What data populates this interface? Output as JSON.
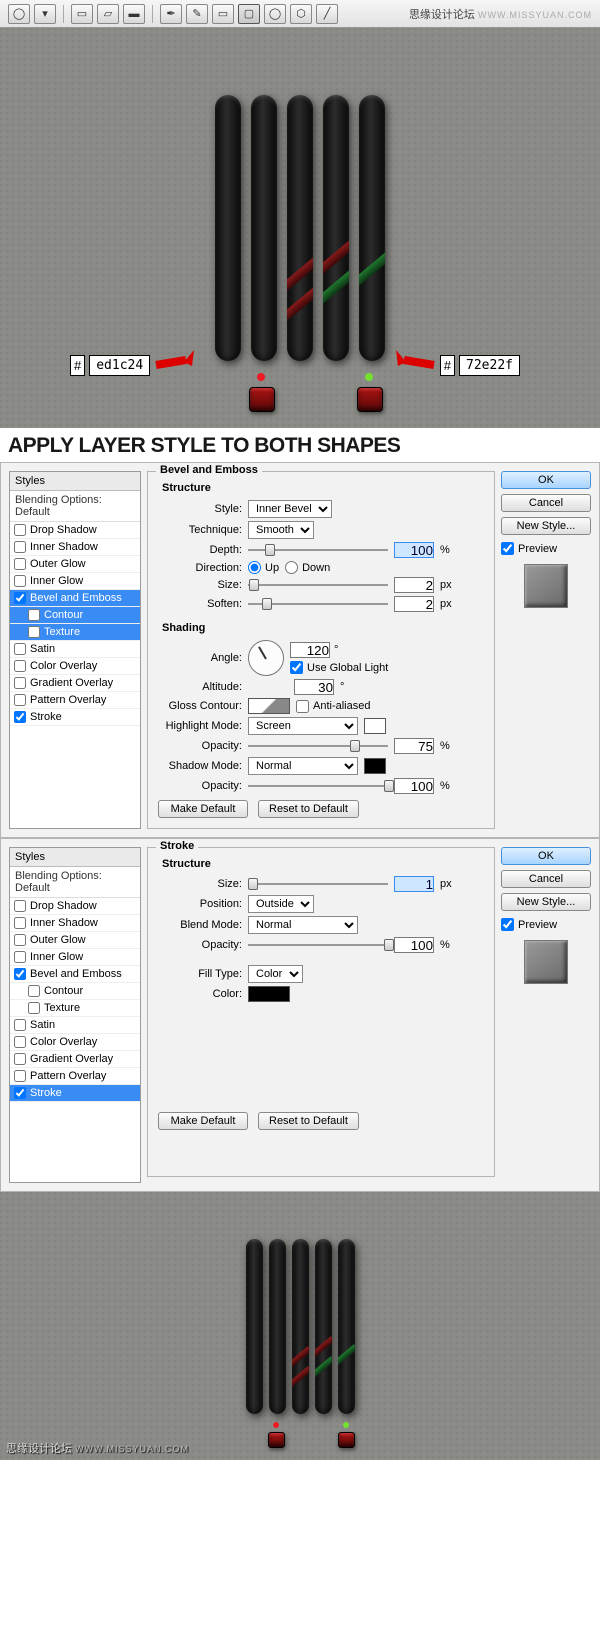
{
  "watermark": {
    "main": "思缘设计论坛",
    "sub": "WWW.MISSYUAN.COM"
  },
  "heading": "APPLY LAYER STYLE TO BOTH SHAPES",
  "colors": {
    "red_hex": "ed1c24",
    "green_hex": "72e22f",
    "hash": "#"
  },
  "styleList": {
    "header": "Styles",
    "sub": "Blending Options: Default",
    "items": [
      "Drop Shadow",
      "Inner Shadow",
      "Outer Glow",
      "Inner Glow",
      "Bevel and Emboss",
      "Contour",
      "Texture",
      "Satin",
      "Color Overlay",
      "Gradient Overlay",
      "Pattern Overlay",
      "Stroke"
    ]
  },
  "buttons": {
    "ok": "OK",
    "cancel": "Cancel",
    "newstyle": "New Style...",
    "preview": "Preview",
    "make_default": "Make Default",
    "reset_default": "Reset to Default"
  },
  "bevel": {
    "group_title": "Bevel and Emboss",
    "structure": "Structure",
    "style_lbl": "Style:",
    "style_val": "Inner Bevel",
    "tech_lbl": "Technique:",
    "tech_val": "Smooth",
    "depth_lbl": "Depth:",
    "depth_val": "100",
    "pct": "%",
    "dir_lbl": "Direction:",
    "up": "Up",
    "down": "Down",
    "size_lbl": "Size:",
    "size_val": "2",
    "px": "px",
    "soften_lbl": "Soften:",
    "soften_val": "2",
    "shading": "Shading",
    "angle_lbl": "Angle:",
    "angle_val": "120",
    "deg": "°",
    "use_global": "Use Global Light",
    "alt_lbl": "Altitude:",
    "alt_val": "30",
    "gloss_lbl": "Gloss Contour:",
    "anti": "Anti-aliased",
    "hl_mode_lbl": "Highlight Mode:",
    "hl_mode_val": "Screen",
    "opacity_lbl": "Opacity:",
    "hl_op": "75",
    "sh_mode_lbl": "Shadow Mode:",
    "sh_mode_val": "Normal",
    "sh_op": "100"
  },
  "stroke": {
    "group_title": "Stroke",
    "structure": "Structure",
    "size_lbl": "Size:",
    "size_val": "1",
    "px": "px",
    "pos_lbl": "Position:",
    "pos_val": "Outside",
    "blend_lbl": "Blend Mode:",
    "blend_val": "Normal",
    "opacity_lbl": "Opacity:",
    "op_val": "100",
    "pct": "%",
    "fill_lbl": "Fill Type:",
    "fill_val": "Color",
    "color_lbl": "Color:"
  }
}
